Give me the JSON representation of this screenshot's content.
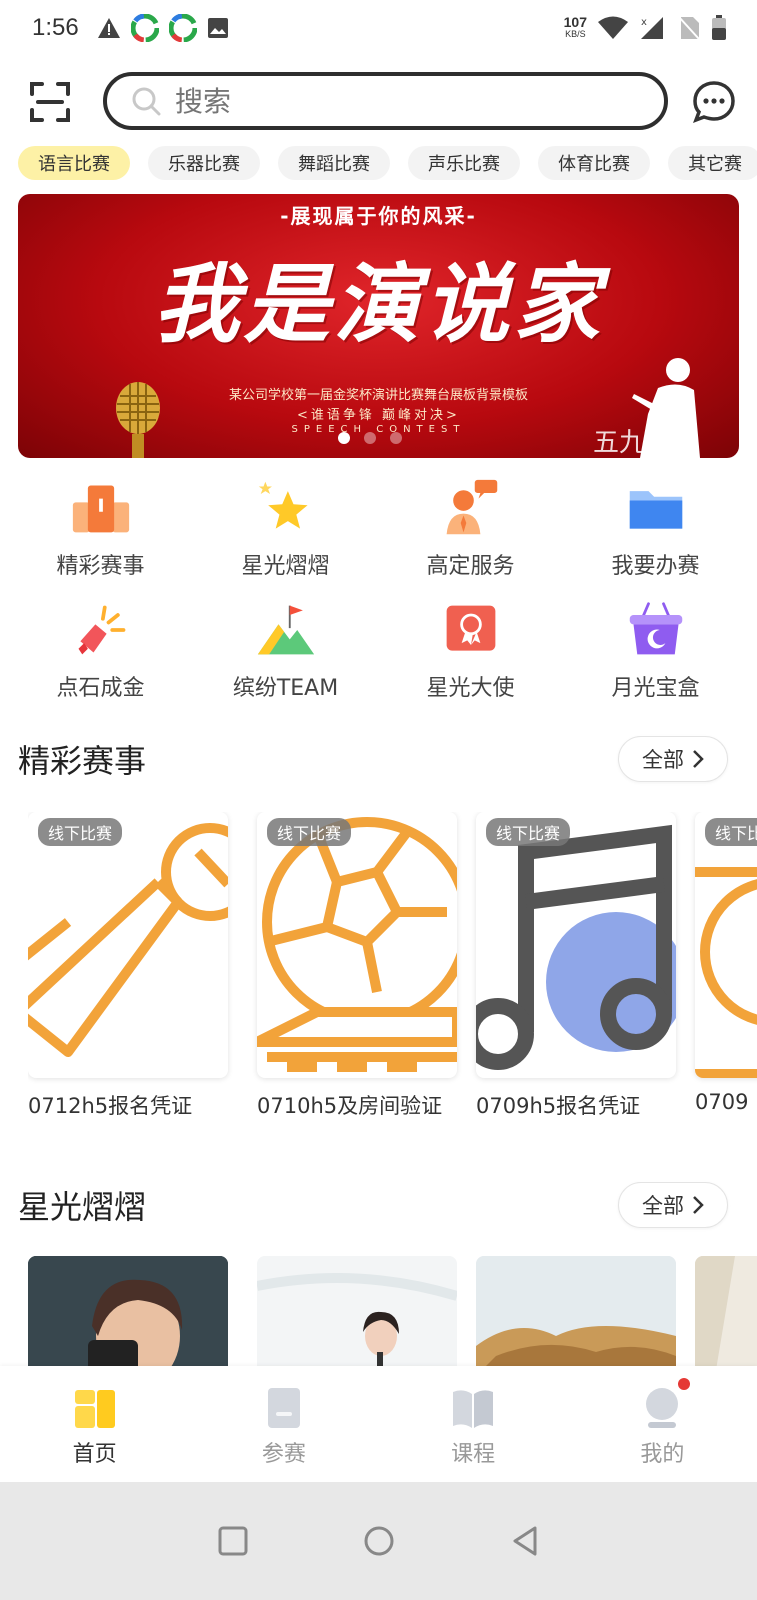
{
  "status_bar": {
    "time": "1:56",
    "net_speed": "107",
    "net_unit": "KB/S"
  },
  "header": {
    "search_placeholder": "搜索"
  },
  "categories": [
    {
      "label": "语言比赛",
      "active": true
    },
    {
      "label": "乐器比赛",
      "active": false
    },
    {
      "label": "舞蹈比赛",
      "active": false
    },
    {
      "label": "声乐比赛",
      "active": false
    },
    {
      "label": "体育比赛",
      "active": false
    },
    {
      "label": "其它赛",
      "active": false
    }
  ],
  "banner": {
    "top_text": "-展现属于你的风采-",
    "title": "我是演说家",
    "sub1": "某公司学校第一届金奖杯演讲比赛舞台展板背景模板",
    "sub2": "<谁语争锋 巅峰对决>",
    "sub3": "SPEECH CONTEST",
    "watermark": "五九件",
    "slide_count": 3,
    "active_slide": 1
  },
  "quick_menu": [
    {
      "label": "精彩赛事",
      "icon": "podium-icon"
    },
    {
      "label": "星光熠熠",
      "icon": "star-icon"
    },
    {
      "label": "高定服务",
      "icon": "service-person-icon"
    },
    {
      "label": "我要办赛",
      "icon": "folder-icon"
    },
    {
      "label": "点石成金",
      "icon": "magic-hand-icon"
    },
    {
      "label": "缤纷TEAM",
      "icon": "mountain-flag-icon"
    },
    {
      "label": "星光大使",
      "icon": "award-badge-icon"
    },
    {
      "label": "月光宝盒",
      "icon": "moon-basket-icon"
    }
  ],
  "events_section": {
    "title": "精彩赛事",
    "more_label": "全部",
    "cards": [
      {
        "tag": "线下比赛",
        "title": "0712h5报名凭证",
        "icon": "microphone-icon"
      },
      {
        "tag": "线下比赛",
        "title": "0710h5及房间验证",
        "icon": "football-icon"
      },
      {
        "tag": "线下比赛",
        "title": "0709h5报名凭证",
        "icon": "music-note-icon"
      },
      {
        "tag": "线下比赛",
        "title": "0709",
        "icon": "microphone-icon"
      }
    ]
  },
  "stars_section": {
    "title": "星光熠熠",
    "more_label": "全部"
  },
  "bottom_nav": [
    {
      "label": "首页",
      "icon": "home-icon",
      "active": true
    },
    {
      "label": "参赛",
      "icon": "join-icon",
      "active": false
    },
    {
      "label": "课程",
      "icon": "book-icon",
      "active": false
    },
    {
      "label": "我的",
      "icon": "profile-icon",
      "active": false,
      "badge": true
    }
  ],
  "colors": {
    "accent_yellow": "#fdf1a6",
    "icon_orange": "#f2a33a",
    "banner_red": "#c8101a"
  }
}
